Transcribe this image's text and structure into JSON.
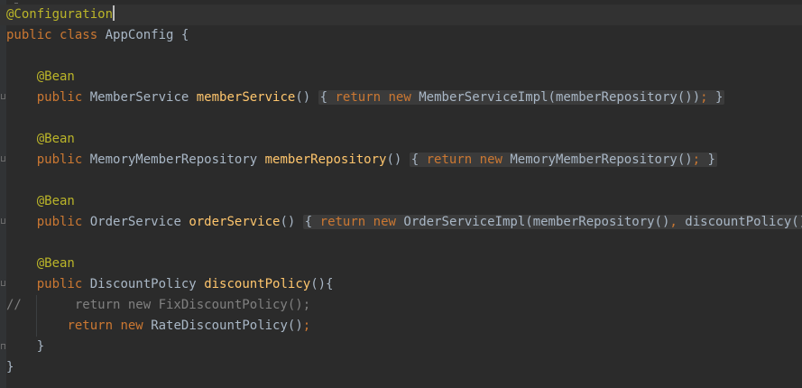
{
  "editor": {
    "code": {
      "configuration_annotation": "@Configuration",
      "public": "public",
      "class": "class",
      "class_name": "AppConfig",
      "open_brace": " {",
      "bean": "@Bean",
      "new": "new",
      "return": "return",
      "member_service_type": "MemberService",
      "member_service_name": "memberService",
      "member_service_impl": "MemberServiceImpl",
      "member_repository_call": "memberRepository()",
      "memory_member_repository_type": "MemoryMemberRepository",
      "member_repository_name": "memberRepository",
      "memory_member_repository_ctor": "MemoryMemberRepository",
      "order_service_type": "OrderService",
      "order_service_name": "orderService",
      "order_service_impl": "OrderServiceImpl",
      "discount_policy_call": "discountPolicy()",
      "discount_policy_type": "DiscountPolicy",
      "discount_policy_name": "discountPolicy",
      "commented_line": "//       return new FixDiscountPolicy();",
      "rate_discount_policy": "RateDiscountPolicy",
      "close_brace": "}"
    }
  }
}
